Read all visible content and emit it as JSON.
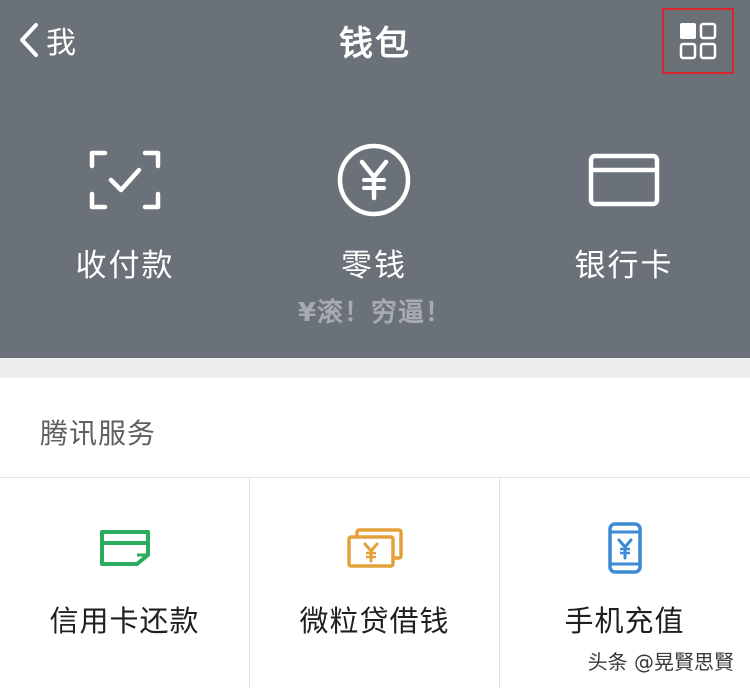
{
  "nav": {
    "back_label": "我",
    "title": "钱包"
  },
  "actions": [
    {
      "label": "收付款",
      "icon": "scan-pay-icon"
    },
    {
      "label": "零钱",
      "icon": "yuan-coin-icon"
    },
    {
      "label": "银行卡",
      "icon": "bank-card-icon"
    }
  ],
  "balance_text": "¥滚！穷逼！",
  "section": {
    "title": "腾讯服务",
    "items": [
      {
        "label": "信用卡还款",
        "icon": "credit-card-icon",
        "color": "#2bab5d"
      },
      {
        "label": "微粒贷借钱",
        "icon": "cash-stack-icon",
        "color": "#e4a13a"
      },
      {
        "label": "手机充值",
        "icon": "phone-topup-icon",
        "color": "#3d89d6"
      }
    ]
  },
  "colors": {
    "header_bg": "#6a7178",
    "highlight_border": "#d8262c"
  },
  "watermark": "头条 @晃賢思賢"
}
